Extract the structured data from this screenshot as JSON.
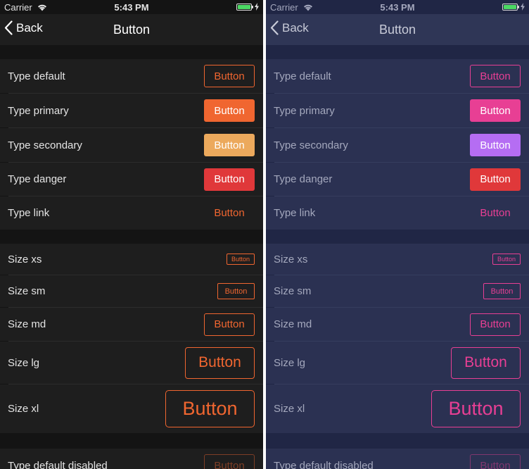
{
  "status_bar": {
    "carrier": "Carrier",
    "time": "5:43 PM"
  },
  "nav": {
    "back_label": "Back",
    "title": "Button"
  },
  "button_label": "Button",
  "rows": {
    "type_default": "Type default",
    "type_primary": "Type primary",
    "type_secondary": "Type secondary",
    "type_danger": "Type danger",
    "type_link": "Type link",
    "size_xs": "Size xs",
    "size_sm": "Size sm",
    "size_md": "Size md",
    "size_lg": "Size lg",
    "size_xl": "Size xl",
    "type_default_disabled": "Type default disabled"
  },
  "themes": {
    "dark": {
      "primary": "#f06630",
      "secondary": "#eca95c",
      "danger": "#e0383a",
      "background": "#141414",
      "row_background": "#1e1e1e"
    },
    "navy": {
      "primary": "#e83f94",
      "secondary": "#b56df3",
      "danger": "#e0383a",
      "background": "#202645",
      "row_background": "#2b3152"
    }
  }
}
